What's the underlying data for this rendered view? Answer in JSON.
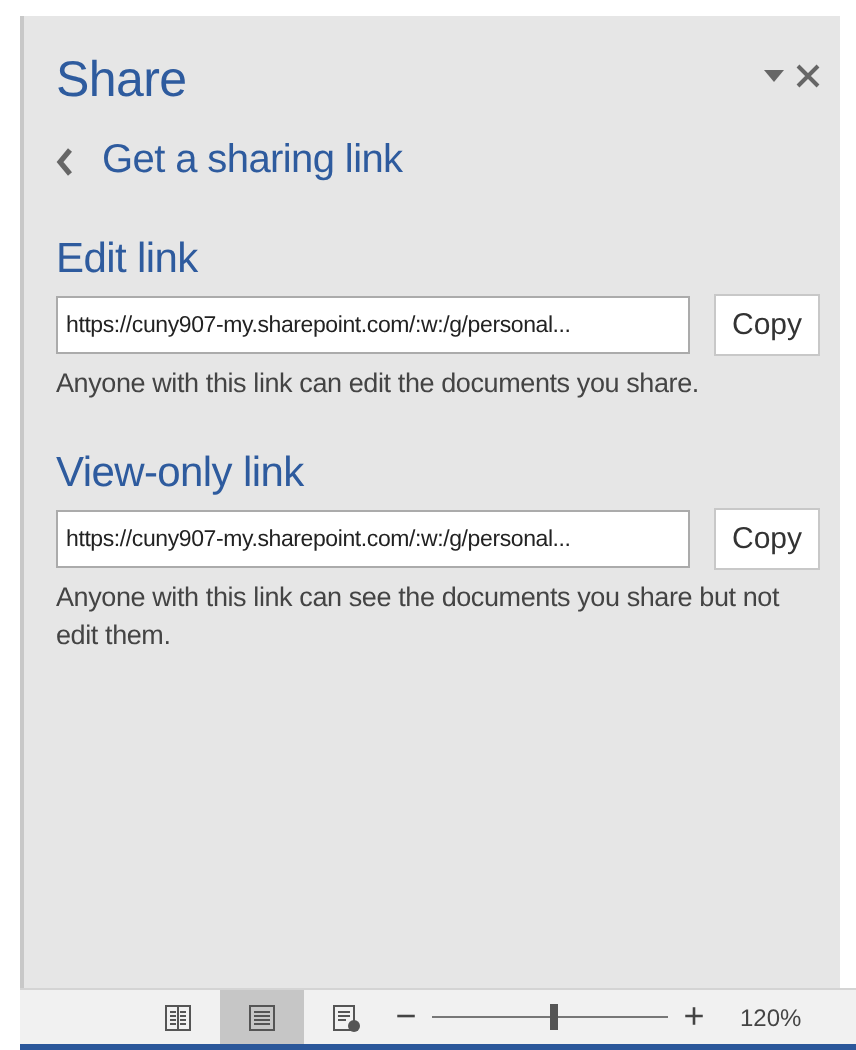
{
  "pane": {
    "title": "Share",
    "subtitle": "Get a sharing link"
  },
  "links": [
    {
      "heading": "Edit link",
      "url": "https://cuny907-my.sharepoint.com/:w:/g/personal...",
      "button": "Copy",
      "description": "Anyone with this link can edit the documents you share."
    },
    {
      "heading": "View-only link",
      "url": "https://cuny907-my.sharepoint.com/:w:/g/personal...",
      "button": "Copy",
      "description": "Anyone with this link can see the documents you share but not edit them."
    }
  ],
  "status_bar": {
    "views": [
      {
        "kind": "read",
        "selected": false
      },
      {
        "kind": "print",
        "selected": true
      },
      {
        "kind": "web",
        "selected": false
      }
    ],
    "zoom_out": "−",
    "zoom_in": "+",
    "zoom": {
      "level": 0.52
    },
    "zoom_label": "120%"
  }
}
